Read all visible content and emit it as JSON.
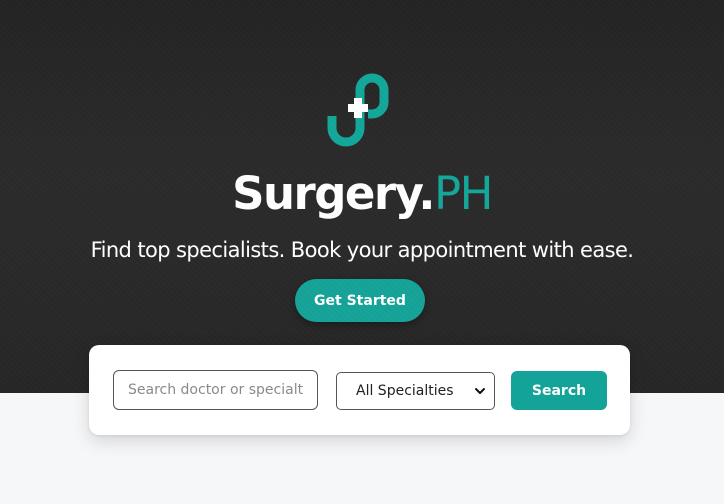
{
  "colors": {
    "hero_bg": "#262626",
    "accent": "#14a79b",
    "page_bg": "#f6f7f9",
    "text_light": "#ffffff"
  },
  "hero": {
    "logo_icon": "stethoscope-cross-logo-icon",
    "brand_main": "Surgery.",
    "brand_accent": "PH",
    "tagline": "Find top specialists. Book your appointment with ease.",
    "cta_label": "Get Started"
  },
  "search": {
    "placeholder": "Search doctor or specialty",
    "specialty_selected": "All Specialties",
    "chevron_icon": "chevron-down-icon",
    "button_label": "Search"
  }
}
